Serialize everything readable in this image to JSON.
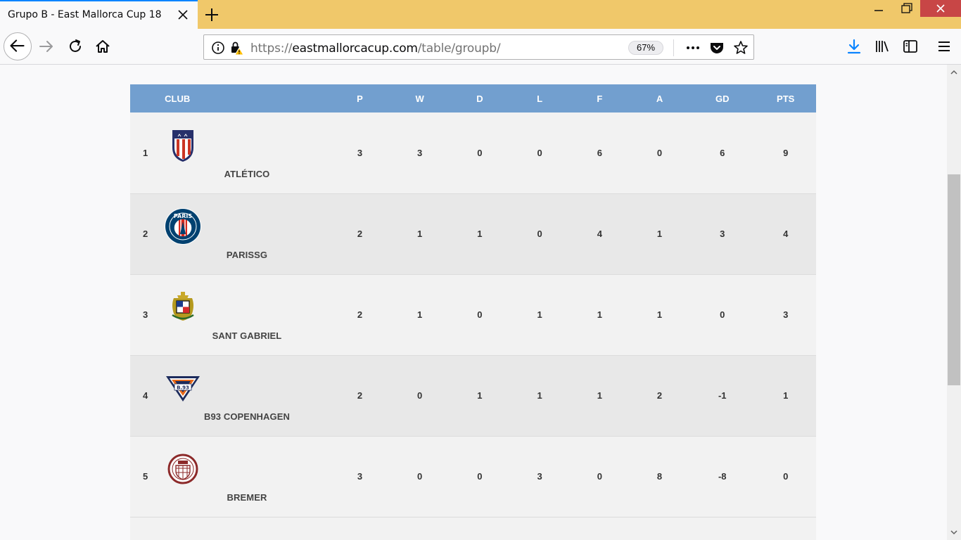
{
  "browser": {
    "tab_title": "Grupo B - East Mallorca Cup 18",
    "url_scheme": "https://",
    "url_host": "eastmallorcacup.com",
    "url_path": "/table/groupb/",
    "zoom": "67%",
    "accent_color": "#0a84ff",
    "titlebar_color": "#f0c86a"
  },
  "table": {
    "header_color": "#729fcf",
    "headers": {
      "club": "CLUB",
      "p": "P",
      "w": "W",
      "d": "D",
      "l": "L",
      "f": "F",
      "a": "A",
      "gd": "GD",
      "pts": "PTS"
    },
    "rows": [
      {
        "pos": "1",
        "club": "ATLÉTICO",
        "crest": "atletico-crest-icon",
        "p": "3",
        "w": "3",
        "d": "0",
        "l": "0",
        "f": "6",
        "a": "0",
        "gd": "6",
        "pts": "9"
      },
      {
        "pos": "2",
        "club": "PARISSG",
        "crest": "psg-crest-icon",
        "p": "2",
        "w": "1",
        "d": "1",
        "l": "0",
        "f": "4",
        "a": "1",
        "gd": "3",
        "pts": "4"
      },
      {
        "pos": "3",
        "club": "SANT GABRIEL",
        "crest": "sant-gabriel-crest-icon",
        "p": "2",
        "w": "1",
        "d": "0",
        "l": "1",
        "f": "1",
        "a": "1",
        "gd": "0",
        "pts": "3"
      },
      {
        "pos": "4",
        "club": "B93 COPENHAGEN",
        "crest": "b93-crest-icon",
        "p": "2",
        "w": "0",
        "d": "1",
        "l": "1",
        "f": "1",
        "a": "2",
        "gd": "-1",
        "pts": "1"
      },
      {
        "pos": "5",
        "club": "BREMER",
        "crest": "bremer-crest-icon",
        "p": "3",
        "w": "0",
        "d": "0",
        "l": "3",
        "f": "0",
        "a": "8",
        "gd": "-8",
        "pts": "0"
      }
    ],
    "crest_texts": {
      "psg_top": "PARIS",
      "b93": "B.93"
    }
  }
}
